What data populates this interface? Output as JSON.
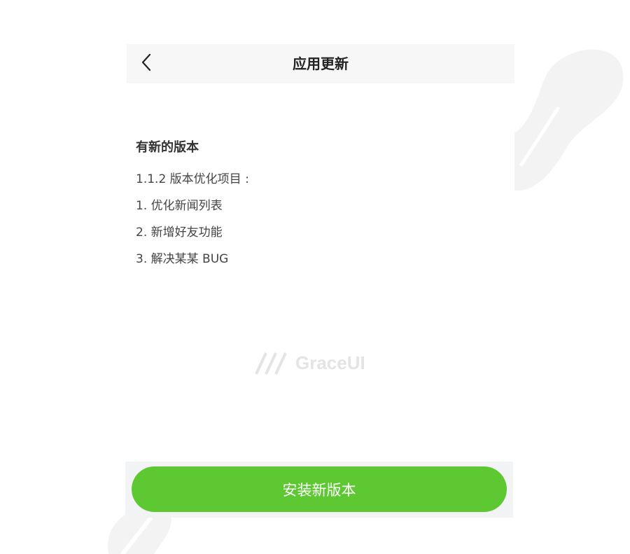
{
  "nav": {
    "title": "应用更新",
    "back_icon": "chevron-left-icon"
  },
  "update": {
    "heading": "有新的版本",
    "notes": [
      "1.1.2 版本优化项目 :",
      "1. 优化新闻列表",
      "2. 新增好友功能",
      "3. 解决某某 BUG"
    ]
  },
  "watermark": {
    "text": "GraceUI"
  },
  "footer": {
    "install_label": "安装新版本"
  },
  "colors": {
    "accent": "#5ec832",
    "nav_bg": "#f7f7f7",
    "footer_bg": "#f2f3f4",
    "decoration": "#f3f3f3"
  }
}
